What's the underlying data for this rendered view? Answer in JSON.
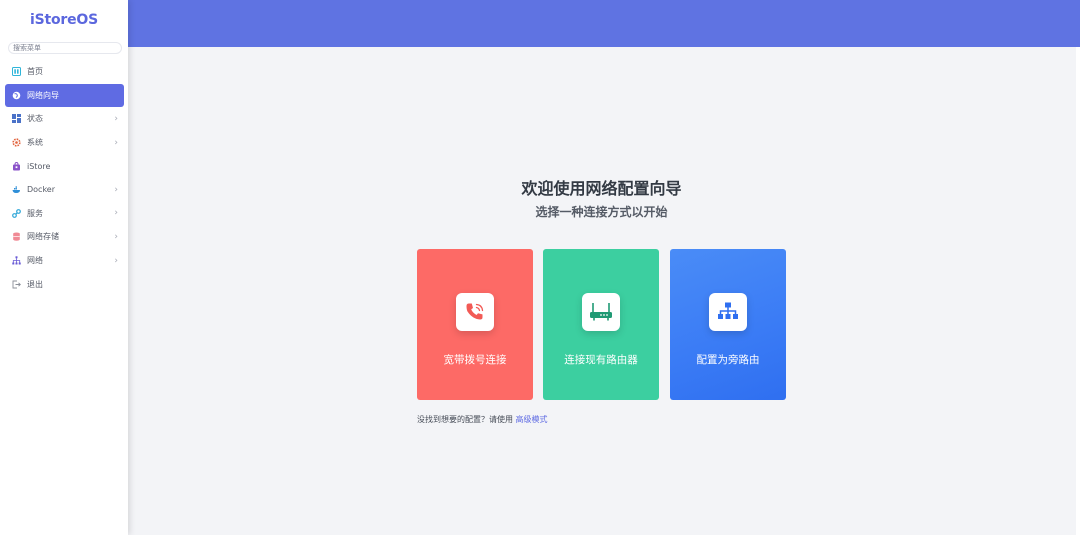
{
  "app": {
    "logo": "iStoreOS",
    "search_placeholder": "搜索菜单"
  },
  "sidebar": {
    "items": [
      {
        "label": "首页",
        "icon": "home-icon",
        "has_children": false,
        "active": false
      },
      {
        "label": "网络向导",
        "icon": "globe-icon",
        "has_children": false,
        "active": true
      },
      {
        "label": "状态",
        "icon": "dashboard-icon",
        "has_children": true,
        "active": false
      },
      {
        "label": "系统",
        "icon": "gear-icon",
        "has_children": true,
        "active": false
      },
      {
        "label": "iStore",
        "icon": "store-icon",
        "has_children": false,
        "active": false
      },
      {
        "label": "Docker",
        "icon": "docker-icon",
        "has_children": true,
        "active": false
      },
      {
        "label": "服务",
        "icon": "service-icon",
        "has_children": true,
        "active": false
      },
      {
        "label": "网络存储",
        "icon": "storage-icon",
        "has_children": true,
        "active": false
      },
      {
        "label": "网络",
        "icon": "network-icon",
        "has_children": true,
        "active": false
      },
      {
        "label": "退出",
        "icon": "logout-icon",
        "has_children": false,
        "active": false
      }
    ]
  },
  "wizard": {
    "title": "欢迎使用网络配置向导",
    "subtitle": "选择一种连接方式以开始",
    "options": [
      {
        "label": "宽带拨号连接",
        "icon": "phone-icon",
        "color": "#fd6a66"
      },
      {
        "label": "连接现有路由器",
        "icon": "router-icon",
        "color": "#3ccfa0"
      },
      {
        "label": "配置为旁路由",
        "icon": "topology-icon",
        "color": "#3a7bf5"
      }
    ],
    "footnote_text": "没找到想要的配置？请使用 ",
    "advanced_link": "高级模式"
  },
  "colors": {
    "topbar": "#5f73e2",
    "accent": "#5f6be3"
  }
}
